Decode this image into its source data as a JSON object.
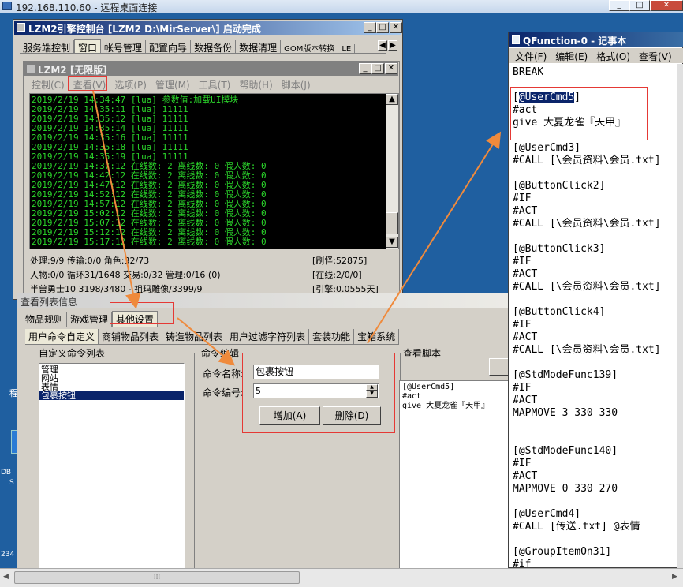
{
  "rdp": {
    "title": "192.168.110.60 - 远程桌面连接"
  },
  "console": {
    "title": "LZM2引擎控制台 [LZM2 D:\\MirServer\\] 启动完成",
    "tabs": [
      "服务端控制",
      "窗口",
      "帐号管理",
      "配置向导",
      "数据备份",
      "数据清理",
      "GOM版本转换",
      "LE"
    ],
    "inner_title": "LZM2 [无限版]",
    "menu": [
      "控制(C)",
      "查看(V)",
      "选项(P)",
      "管理(M)",
      "工具(T)",
      "帮助(H)",
      "脚本(J)"
    ],
    "log_lines": [
      "2019/2/19 14:34:47 [lua] 参数值:加载UI模块",
      "2019/2/19 14:35:11 [lua] 11111",
      "2019/2/19 14:35:12 [lua] 11111",
      "2019/2/19 14:35:14 [lua] 11111",
      "2019/2/19 14:35:16 [lua] 11111",
      "2019/2/19 14:35:18 [lua] 11111",
      "2019/2/19 14:35:19 [lua] 11111",
      "2019/2/19 14:37:12 在线数: 2 离线数: 0 假人数: 0",
      "2019/2/19 14:42:12 在线数: 2 离线数: 0 假人数: 0",
      "2019/2/19 14:47:12 在线数: 2 离线数: 0 假人数: 0",
      "2019/2/19 14:52:12 在线数: 2 离线数: 0 假人数: 0",
      "2019/2/19 14:57:12 在线数: 2 离线数: 0 假人数: 0",
      "2019/2/19 15:02:12 在线数: 2 离线数: 0 假人数: 0",
      "2019/2/19 15:07:12 在线数: 2 离线数: 0 假人数: 0",
      "2019/2/19 15:12:12 在线数: 2 离线数: 0 假人数: 0",
      "2019/2/19 15:17:12 在线数: 2 离线数: 0 假人数: 0"
    ],
    "status": {
      "l1": "处理:9/9 传输:0/0 角色:32/73",
      "r1": "[刷怪:52875]",
      "l2": "人物:0/0 循环31/1648 交易:0/32 管理:0/16 (0)",
      "r2": "[在线:2/0/0]",
      "l3": "半兽勇士10 3198/3480 - 祖玛雕像/3399/9",
      "r3": "[引擎:0.0555天]"
    }
  },
  "dialog": {
    "title": "查看列表信息",
    "tabs1": [
      "物品规则",
      "游戏管理",
      "其他设置"
    ],
    "tabs2": [
      "用户命令自定义",
      "商铺物品列表",
      "铸造物品列表",
      "用户过滤字符列表",
      "套装功能",
      "宝箱系统"
    ],
    "list_group": "自定义命令列表",
    "list_items": [
      "管理",
      "网站",
      "表情",
      "包裹按钮"
    ],
    "edit_group": "命令编辑",
    "name_label": "命令名称:",
    "name_value": "包裹按钮",
    "num_label": "命令编号:",
    "num_value": "5",
    "add_btn": "增加(A)",
    "del_btn": "删除(D)",
    "script_label": "查看脚本",
    "script_lines": [
      "[@UserCmd5]",
      "#act",
      "give 大夏龙雀『天甲』"
    ]
  },
  "notepad": {
    "title": "QFunction-0 - 记事本",
    "menu": [
      "文件(F)",
      "编辑(E)",
      "格式(O)",
      "查看(V)"
    ],
    "selected": "@UserCmd5",
    "lines": [
      "BREAK",
      "",
      "[@UserCmd5]",
      "#act",
      "give 大夏龙雀『天甲』",
      "",
      "[@UserCmd3]",
      "#CALL [\\会员资料\\会员.txt]",
      "",
      "[@ButtonClick2]",
      "#IF",
      "#ACT",
      "#CALL [\\会员资料\\会员.txt]",
      "",
      "[@ButtonClick3]",
      "#IF",
      "#ACT",
      "#CALL [\\会员资料\\会员.txt]",
      "",
      "[@ButtonClick4]",
      "#IF",
      "#ACT",
      "#CALL [\\会员资料\\会员.txt]",
      "",
      "[@StdModeFunc139]",
      "#IF",
      "#ACT",
      "MAPMOVE 3 330 330",
      "",
      "",
      "[@StdModeFunc140]",
      "#IF",
      "#ACT",
      "MAPMOVE 0 330 270",
      "",
      "[@UserCmd4]",
      "#CALL [传送.txt] @表情",
      "",
      "[@GroupItemOn31]",
      "#if"
    ]
  },
  "desktop": {
    "l1": "DB",
    "l2": "S",
    "l3": "234",
    "l4": "程"
  },
  "colors": {
    "log_green": "#2bd62b",
    "highlight": "#e53935",
    "arrow": "#ef8a3c",
    "selection": "#0a246a"
  }
}
